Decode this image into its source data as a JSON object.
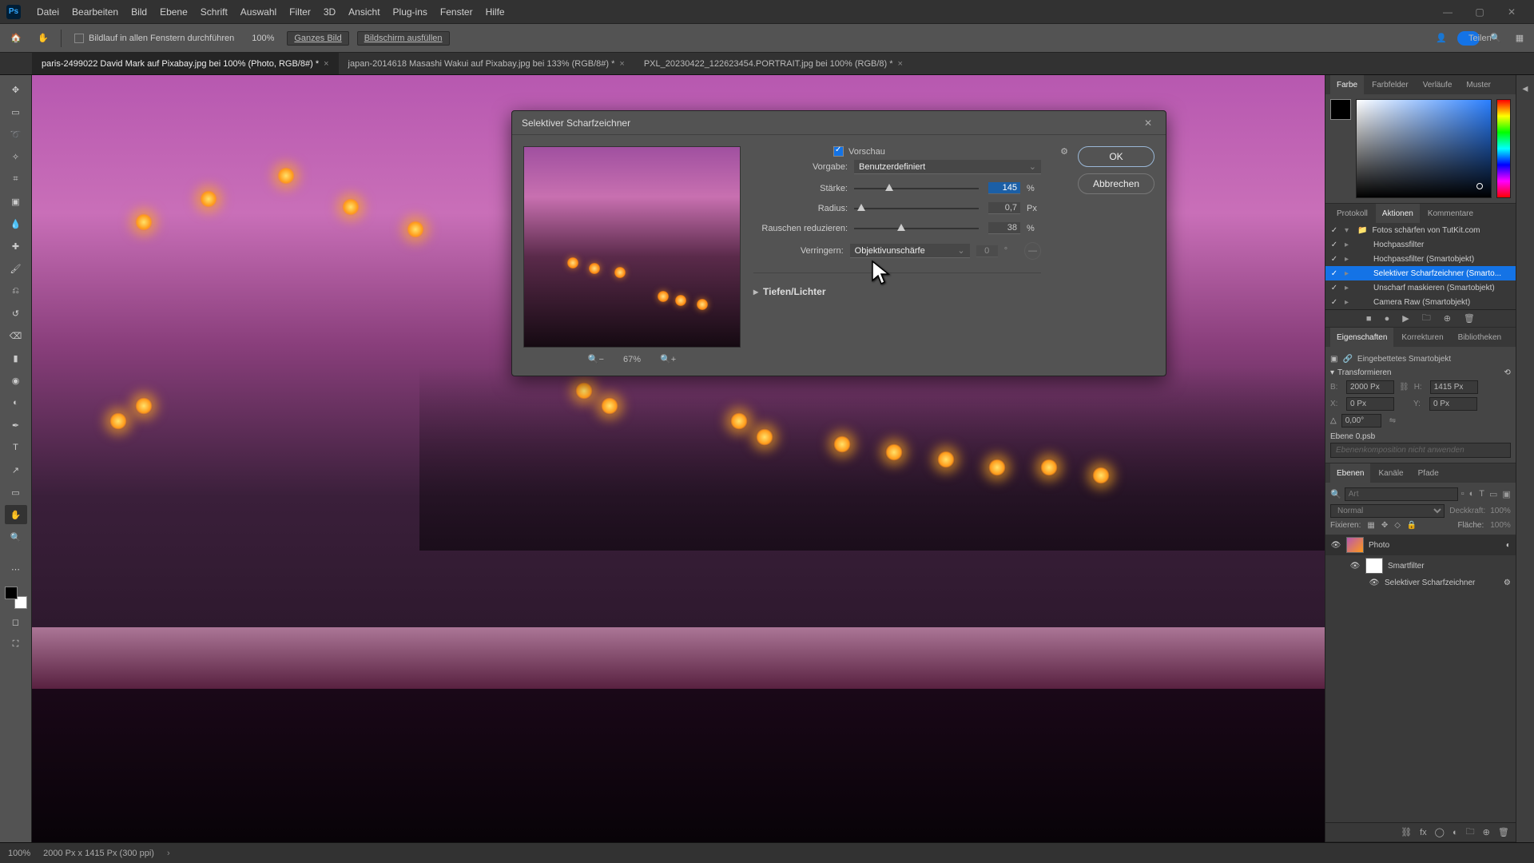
{
  "menu": [
    "Datei",
    "Bearbeiten",
    "Bild",
    "Ebene",
    "Schrift",
    "Auswahl",
    "Filter",
    "3D",
    "Ansicht",
    "Plug-ins",
    "Fenster",
    "Hilfe"
  ],
  "options": {
    "scroll_all": "Bildlauf in allen Fenstern durchführen",
    "zoom": "100%",
    "full_image": "Ganzes Bild",
    "fill_screen": "Bildschirm ausfüllen",
    "share": "Teilen"
  },
  "doctabs": [
    "paris-2499022  David Mark auf Pixabay.jpg bei 100% (Photo, RGB/8#) *",
    "japan-2014618 Masashi Wakui auf Pixabay.jpg bei 133% (RGB/8#) *",
    "PXL_20230422_122623454.PORTRAIT.jpg bei 100% (RGB/8) *"
  ],
  "dialog": {
    "title": "Selektiver Scharfzeichner",
    "preview_label": "Vorschau",
    "preset_label": "Vorgabe:",
    "preset_value": "Benutzerdefiniert",
    "amount_label": "Stärke:",
    "amount_value": "145",
    "amount_unit": "%",
    "radius_label": "Radius:",
    "radius_value": "0,7",
    "radius_unit": "Px",
    "noise_label": "Rauschen reduzieren:",
    "noise_value": "38",
    "noise_unit": "%",
    "remove_label": "Verringern:",
    "remove_value": "Objektivunschärfe",
    "remove_num": "0",
    "remove_deg": "°",
    "shadows_title": "Tiefen/Lichter",
    "ok": "OK",
    "cancel": "Abbrechen",
    "zoom_pct": "67%"
  },
  "color_tabs": [
    "Farbe",
    "Farbfelder",
    "Verläufe",
    "Muster"
  ],
  "actions_tabs": [
    "Protokoll",
    "Aktionen",
    "Kommentare"
  ],
  "actions": [
    {
      "label": "Fotos schärfen von TutKit.com",
      "folder": true
    },
    {
      "label": "Hochpassfilter"
    },
    {
      "label": "Hochpassfilter (Smartobjekt)"
    },
    {
      "label": "Selektiver Scharfzeichner (Smarto...",
      "selected": true
    },
    {
      "label": "Unscharf maskieren (Smartobjekt)"
    },
    {
      "label": "Camera Raw (Smartobjekt)"
    }
  ],
  "props_tabs": [
    "Eigenschaften",
    "Korrekturen",
    "Bibliotheken"
  ],
  "props": {
    "embedded": "Eingebettetes Smartobjekt",
    "transform_title": "Transformieren",
    "w_label": "B:",
    "w_val": "2000 Px",
    "h_label": "H:",
    "h_val": "1415 Px",
    "x_label": "X:",
    "x_val": "0 Px",
    "y_label": "Y:",
    "y_val": "0 Px",
    "angle": "0,00°",
    "layer_title": "Ebene 0.psb",
    "comp_hint": "Ebenenkomposition nicht anwenden"
  },
  "layers_tabs": [
    "Ebenen",
    "Kanäle",
    "Pfade"
  ],
  "layers": {
    "search_placeholder": "Art",
    "blend": "Normal",
    "opacity_label": "Deckkraft:",
    "opacity_val": "100%",
    "lock_label": "Fixieren:",
    "fill_label": "Fläche:",
    "fill_val": "100%",
    "layer_name": "Photo",
    "smart_name": "Smartfilter",
    "filter_name": "Selektiver Scharfzeichner"
  },
  "status": {
    "zoom": "100%",
    "dims": "2000 Px x 1415 Px (300 ppi)"
  }
}
